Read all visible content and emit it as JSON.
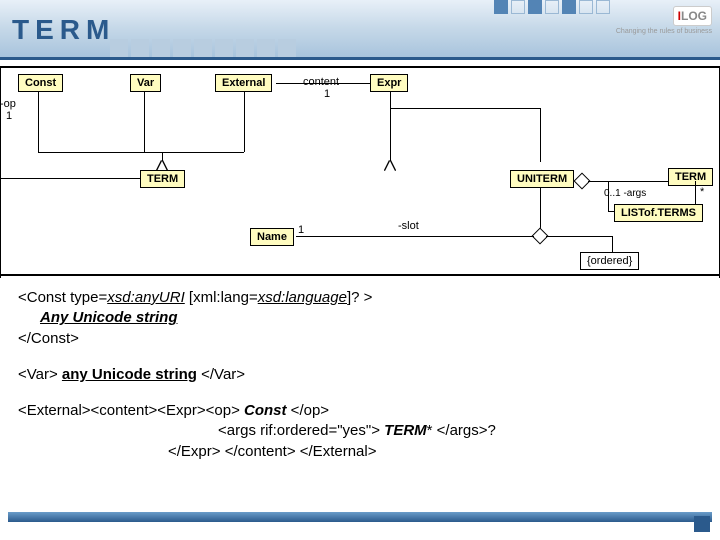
{
  "header": {
    "title": "TERM",
    "logo_text": "I",
    "logo_text2": "LOG",
    "logo_sub": "Changing the rules of business"
  },
  "diagram": {
    "boxes": {
      "const": "Const",
      "var": "Var",
      "external": "External",
      "expr": "Expr",
      "term_main": "TERM",
      "uniterm": "UNITERM",
      "term_right": "TERM",
      "listofterms": "LISTof.TERMS",
      "name": "Name"
    },
    "labels": {
      "op": "-op",
      "one_a": "1",
      "content": "content",
      "one_b": "1",
      "slot": "-slot",
      "args": "0..1 -args",
      "star": "*",
      "one_c": "1",
      "ordered": "{ordered}"
    }
  },
  "code": {
    "line1a": "<Const type=",
    "line1b": "xsd:anyURI",
    "line1c": " [xml:lang=",
    "line1d": "xsd:language",
    "line1e": "]? >",
    "line2": "Any Unicode string",
    "line3": "</Const>",
    "line4a": "<Var> ",
    "line4b": "any Unicode string",
    "line4c": " </Var>",
    "line5a": "<External><content><Expr><op> ",
    "line5b": "Const",
    "line5c": " </op>",
    "line6a": "<args rif:ordered=\"yes\"> ",
    "line6b": "TERM",
    "line6c": "*",
    "line6d": " </args>?",
    "line7": "</Expr> </content> </External>"
  }
}
